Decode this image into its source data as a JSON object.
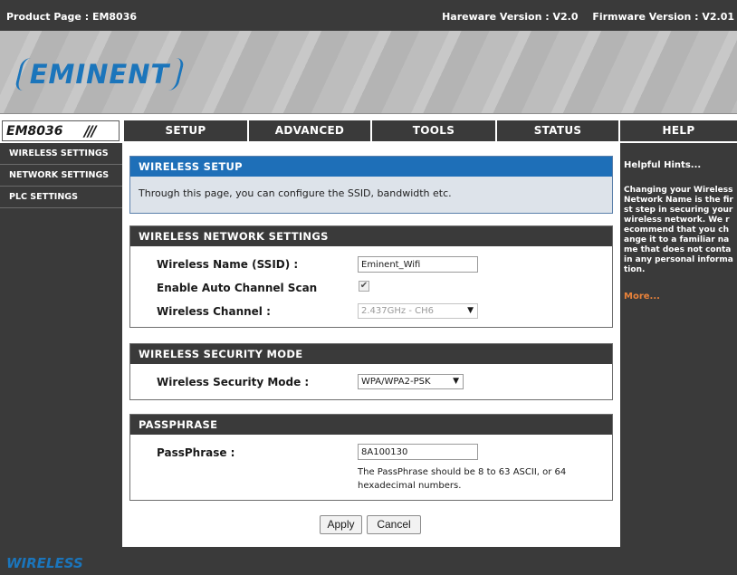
{
  "topbar": {
    "product": "Product Page : EM8036",
    "hardware": "Hareware Version : V2.0",
    "firmware": "Firmware Version : V2.01"
  },
  "banner": {
    "logo_text": "EMINENT"
  },
  "nav": {
    "model": "EM8036",
    "model_mark": "///",
    "tabs": [
      "SETUP",
      "ADVANCED",
      "TOOLS",
      "STATUS",
      "HELP"
    ]
  },
  "sidebar": {
    "items": [
      {
        "label": "WIRELESS SETTINGS"
      },
      {
        "label": "NETWORK SETTINGS"
      },
      {
        "label": "PLC SETTINGS"
      }
    ]
  },
  "setup": {
    "title": "WIRELESS SETUP",
    "description": "Through this page, you can configure the SSID, bandwidth etc."
  },
  "network": {
    "title": "WIRELESS NETWORK SETTINGS",
    "ssid_label": "Wireless Name (SSID) :",
    "ssid_value": "Eminent_Wifi",
    "auto_scan_label": "Enable Auto Channel Scan",
    "auto_scan_checked": true,
    "check_glyph": "✔",
    "channel_label": "Wireless Channel :",
    "channel_value": "2.437GHz - CH6"
  },
  "security": {
    "title": "WIRELESS SECURITY MODE",
    "mode_label": "Wireless Security Mode :",
    "mode_value": "WPA/WPA2-PSK"
  },
  "passphrase": {
    "title": "PASSPHRASE",
    "label": "PassPhrase :",
    "value": "8A100130",
    "note": "The PassPhrase should be 8 to 63 ASCII, or 64 hexadecimal numbers."
  },
  "actions": {
    "apply": "Apply",
    "cancel": "Cancel"
  },
  "select_arrow": "▼",
  "hints": {
    "title": "Helpful Hints...",
    "body": "Changing your Wireless Network Name is the first step in securing your wireless network. We recommend that you change it to a familiar name that does not contain any personal information.",
    "more": "More..."
  },
  "footer": {
    "text": "WIRELESS"
  },
  "colors": {
    "dark_gray": "#3a3a3a",
    "accent_blue": "#1e6fb8",
    "brand_blue": "#1b75bb",
    "more_orange": "#e8823a"
  },
  "icons": {
    "checkbox": "checkmark-icon",
    "dropdown": "chevron-down-icon"
  }
}
